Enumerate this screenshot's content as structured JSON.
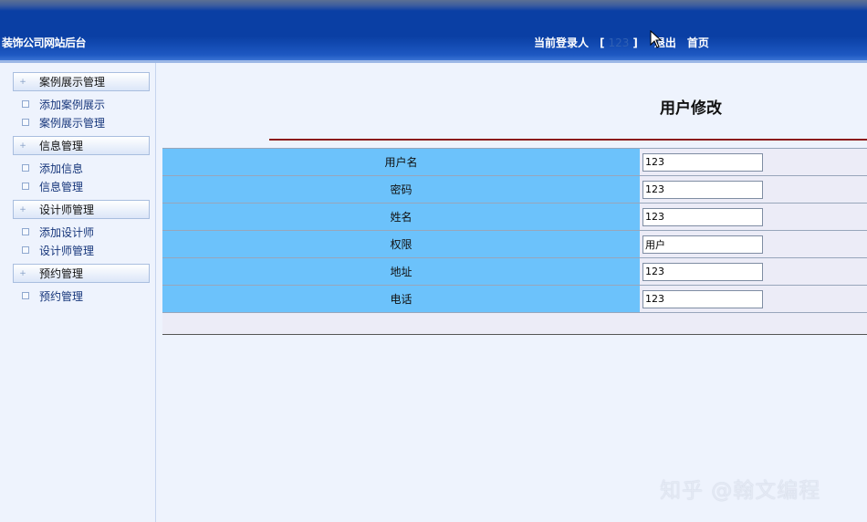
{
  "header": {
    "site_title": "装饰公司网站后台",
    "current_user_label": "当前登录人",
    "bracket_open": "[",
    "current_user": "123",
    "bracket_close": "]",
    "logout": "退出",
    "home": "首页"
  },
  "sidebar": {
    "groups": [
      {
        "label": "案例展示管理",
        "items": [
          "添加案例展示",
          "案例展示管理"
        ]
      },
      {
        "label": "信息管理",
        "items": [
          "添加信息",
          "信息管理"
        ]
      },
      {
        "label": "设计师管理",
        "items": [
          "添加设计师",
          "设计师管理"
        ]
      },
      {
        "label": "预约管理",
        "items": [
          "预约管理"
        ]
      }
    ]
  },
  "main": {
    "title": "用户修改",
    "fields": [
      {
        "label": "用户名",
        "value": "123"
      },
      {
        "label": "密码",
        "value": "123"
      },
      {
        "label": "姓名",
        "value": "123"
      },
      {
        "label": "权限",
        "value": "用户"
      },
      {
        "label": "地址",
        "value": "123"
      },
      {
        "label": "电话",
        "value": "123"
      }
    ]
  },
  "watermark": "知乎 @翰文编程",
  "icons": {
    "cursor": "mouse-cursor-icon",
    "expand": "plus-icon",
    "item": "square-bullet-icon"
  },
  "colors": {
    "header": "#0a3fa4",
    "label_cell": "#6cc2fb",
    "value_cell": "#ececf7",
    "title_line": "#8b1a1a",
    "background": "#eef3fd"
  }
}
